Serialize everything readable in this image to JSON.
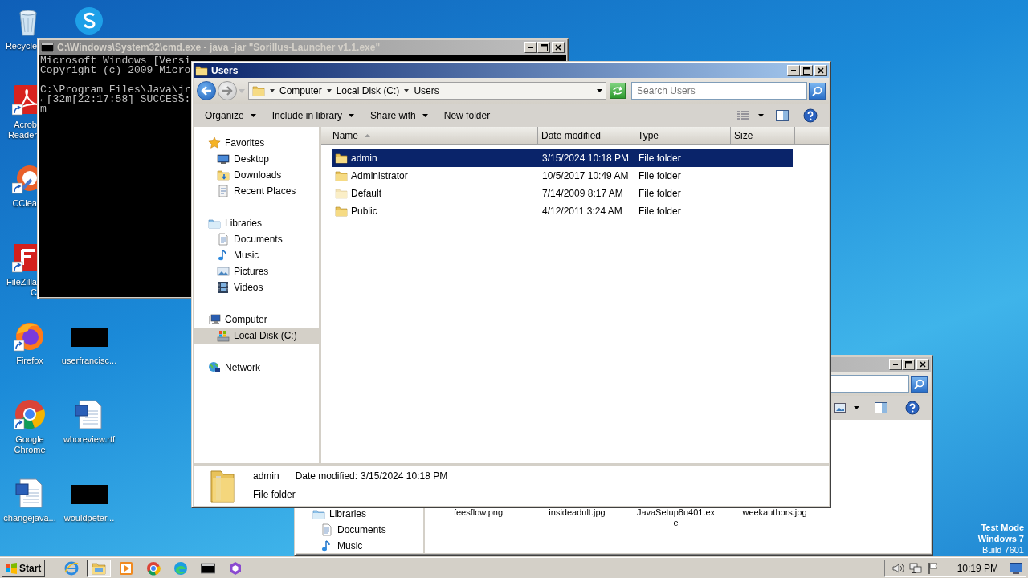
{
  "desktop_icons": [
    {
      "label": "Recycle",
      "kind": "recycle",
      "shortcut": false
    },
    {
      "label": "Acrob Reader",
      "kind": "acrobat",
      "shortcut": true
    },
    {
      "label": "CClea",
      "kind": "ccleaner",
      "shortcut": true
    },
    {
      "label": "FileZilla C",
      "kind": "filezilla",
      "shortcut": true
    },
    {
      "label": "Firefox",
      "kind": "firefox",
      "shortcut": true
    },
    {
      "label": "Google Chrome",
      "kind": "chrome",
      "shortcut": true
    },
    {
      "label": "changejava...",
      "kind": "document",
      "shortcut": false
    },
    {
      "kind": "skype",
      "shortcut": false
    },
    {
      "label": "userfrancisc...",
      "kind": "blank",
      "shortcut": false
    },
    {
      "label": "whoreview.rtf",
      "kind": "document",
      "shortcut": false
    },
    {
      "label": "wouldpeter...",
      "kind": "blank",
      "shortcut": false
    }
  ],
  "cmd_window": {
    "title": "C:\\Windows\\System32\\cmd.exe - java  -jar \"Sorillus-Launcher v1.1.exe\"",
    "active": false,
    "blocks": [
      [
        "Microsoft Windows [Versi",
        "Copyright (c) 2009 Micro"
      ],
      [
        "C:\\Program Files\\Java\\jr",
        "←[32m[22:17:58] SUCCESS:",
        "m"
      ]
    ]
  },
  "background_window": {
    "active": false,
    "navigation": [
      {
        "label": "Libraries",
        "kind": "libraries",
        "children": [
          {
            "label": "Documents",
            "kind": "documents"
          },
          {
            "label": "Music",
            "kind": "music"
          }
        ]
      }
    ],
    "files": [
      "feesflow.png",
      "insideadult.jpg",
      "JavaSetup8u401.exe",
      "weekauthors.jpg"
    ]
  },
  "explorer": {
    "title": "Users",
    "active": true,
    "breadcrumb": [
      "Computer",
      "Local Disk (C:)",
      "Users"
    ],
    "search": {
      "placeholder": "Search Users"
    },
    "toolbar": [
      {
        "label": "Organize",
        "has_menu": true
      },
      {
        "label": "Include in library",
        "has_menu": true
      },
      {
        "label": "Share with",
        "has_menu": true
      },
      {
        "label": "New folder",
        "has_menu": false
      }
    ],
    "navigation": [
      {
        "label": "Favorites",
        "kind": "favorites",
        "selected": false,
        "children": [
          {
            "label": "Desktop",
            "kind": "desktop",
            "selected": false
          },
          {
            "label": "Downloads",
            "kind": "downloads",
            "selected": false
          },
          {
            "label": "Recent Places",
            "kind": "recent",
            "selected": false
          }
        ]
      },
      {
        "label": "Libraries",
        "kind": "libraries",
        "selected": false,
        "children": [
          {
            "label": "Documents",
            "kind": "documents",
            "selected": false
          },
          {
            "label": "Music",
            "kind": "music",
            "selected": false
          },
          {
            "label": "Pictures",
            "kind": "pictures",
            "selected": false
          },
          {
            "label": "Videos",
            "kind": "videos",
            "selected": false
          }
        ]
      },
      {
        "label": "Computer",
        "kind": "computer",
        "selected": false,
        "children": [
          {
            "label": "Local Disk (C:)",
            "kind": "disk",
            "selected": true
          }
        ]
      },
      {
        "label": "Network",
        "kind": "network",
        "selected": false
      }
    ],
    "columns": [
      {
        "label": "Name",
        "sorted": true
      },
      {
        "label": "Date modified",
        "sorted": false
      },
      {
        "label": "Type",
        "sorted": false
      },
      {
        "label": "Size",
        "sorted": false
      }
    ],
    "rows": [
      {
        "name": "admin",
        "date_modified": "3/15/2024 10:18 PM",
        "type": "File folder",
        "selected": true,
        "hidden": false
      },
      {
        "name": "Administrator",
        "date_modified": "10/5/2017 10:49 AM",
        "type": "File folder",
        "selected": false,
        "hidden": false
      },
      {
        "name": "Default",
        "date_modified": "7/14/2009 8:17 AM",
        "type": "File folder",
        "selected": false,
        "hidden": true
      },
      {
        "name": "Public",
        "date_modified": "4/12/2011 3:24 AM",
        "type": "File folder",
        "selected": false,
        "hidden": false
      }
    ],
    "details": {
      "name": "admin",
      "date_label": "Date modified:",
      "date": "3/15/2024 10:18 PM",
      "type": "File folder"
    }
  },
  "watermark_text": [
    "Test Mode",
    "Windows 7",
    "Build 7601"
  ],
  "taskbar": {
    "start": "Start",
    "apps": [
      {
        "kind": "ie",
        "active": false
      },
      {
        "kind": "explorer",
        "active": true
      },
      {
        "kind": "media",
        "active": false
      },
      {
        "kind": "chrome",
        "active": false
      },
      {
        "kind": "edge",
        "active": false
      },
      {
        "kind": "cmd",
        "active": false
      },
      {
        "kind": "hex",
        "active": false
      }
    ],
    "clock": "10:19 PM"
  }
}
